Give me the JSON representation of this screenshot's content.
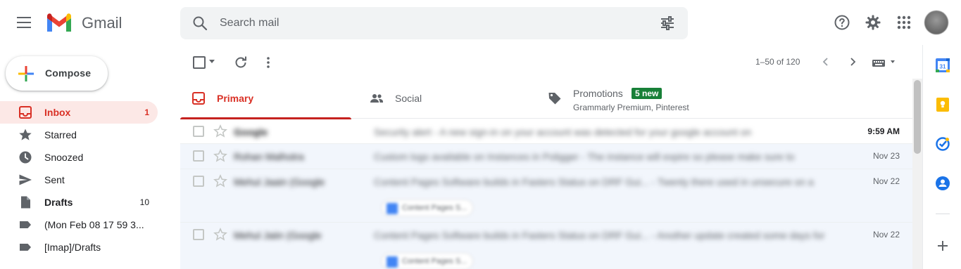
{
  "app": {
    "brand": "Gmail"
  },
  "header": {
    "search_placeholder": "Search mail"
  },
  "sidebar": {
    "compose_label": "Compose",
    "items": [
      {
        "label": "Inbox",
        "count": "1",
        "icon": "inbox-icon",
        "active": true
      },
      {
        "label": "Starred",
        "count": "",
        "icon": "star-icon"
      },
      {
        "label": "Snoozed",
        "count": "",
        "icon": "clock-icon"
      },
      {
        "label": "Sent",
        "count": "",
        "icon": "send-icon"
      },
      {
        "label": "Drafts",
        "count": "10",
        "icon": "draft-icon",
        "bold": true
      },
      {
        "label": "(Mon Feb 08 17 59 3...",
        "count": "",
        "icon": "label-icon"
      },
      {
        "label": "[Imap]/Drafts",
        "count": "",
        "icon": "label-icon"
      }
    ]
  },
  "toolbar": {
    "page_info": "1–50 of 120"
  },
  "tabs": {
    "primary": "Primary",
    "social": "Social",
    "promotions": "Promotions",
    "promotions_badge": "5 new",
    "promotions_sub": "Grammarly Premium, Pinterest"
  },
  "emails": [
    {
      "sender": "Google",
      "snippet": "Security alert - A new sign-in on your account was detected for your google account on",
      "date": "9:59 AM",
      "unread": true
    },
    {
      "sender": "Rohan Malhotra",
      "snippet": "Custom logo available on Instances in Poligger - The instance will expire so please make sure to",
      "date": "Nov 23",
      "unread": false
    },
    {
      "sender": "Mehul Jaain (Google",
      "snippet": "Content Pages Software builds in Fasters Status on DRF Gui... - Twenty there used in unsecure on a",
      "date": "Nov 22",
      "unread": false,
      "attachment": "Content Pages S..."
    },
    {
      "sender": "Mehul Jaiin (Google",
      "snippet": "Content Pages Software builds in Fasters Status on DRF Gui... - Another update created some days for",
      "date": "Nov 22",
      "unread": false,
      "attachment": "Content Pages S..."
    }
  ],
  "colors": {
    "accent": "#d93025",
    "badge": "#188038",
    "active_bg": "#fce8e6"
  }
}
